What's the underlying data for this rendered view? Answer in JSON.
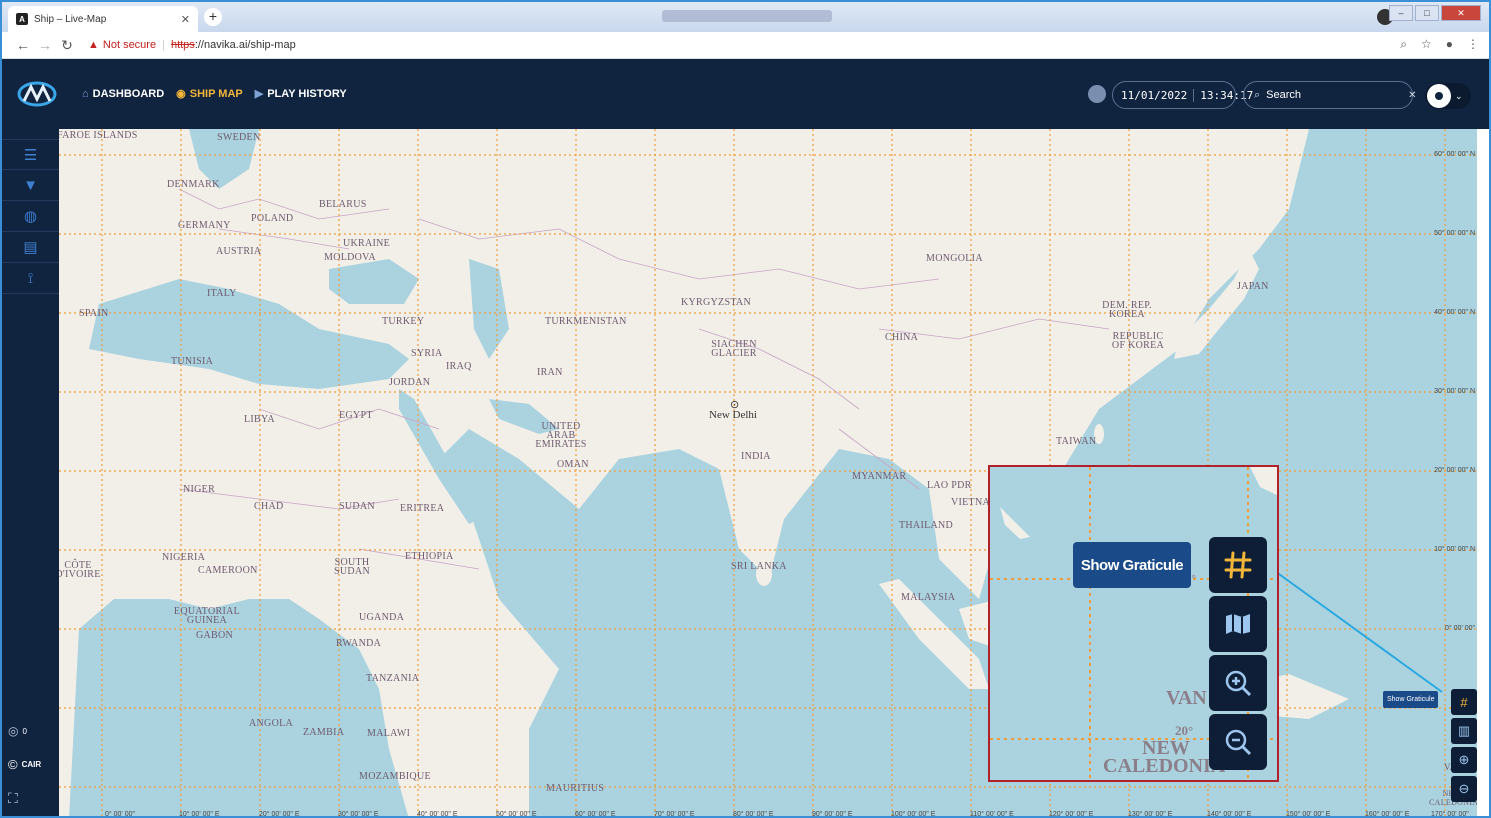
{
  "browser": {
    "tab_title": "Ship – Live-Map",
    "tab_favicon": "A",
    "new_tab": "+",
    "not_secure": "Not secure",
    "url_scheme": "https",
    "url_rest": "://navika.ai/ship-map",
    "window_buttons": [
      "–",
      "□",
      "✕"
    ]
  },
  "header": {
    "nav": [
      {
        "label": "DASHBOARD",
        "icon": "home-icon"
      },
      {
        "label": "SHIP MAP",
        "icon": "target-icon",
        "active": true
      },
      {
        "label": "PLAY HISTORY",
        "icon": "play-icon"
      }
    ],
    "date": "11/01/2022",
    "time": "13:34:17",
    "search_placeholder": "Search"
  },
  "sidebar": {
    "items": [
      {
        "icon": "menu-icon",
        "glyph": "☰"
      },
      {
        "icon": "filter-icon",
        "glyph": "▼"
      },
      {
        "icon": "globe-icon",
        "glyph": "◍"
      },
      {
        "icon": "layers-icon",
        "glyph": "▤"
      },
      {
        "icon": "route-icon",
        "glyph": "⟟"
      }
    ],
    "count": "0",
    "cair_label": "CAIR"
  },
  "map": {
    "countries": [
      {
        "text": "SWEDEN"
      },
      {
        "text": "FAROE ISLANDS"
      },
      {
        "text": "DENMARK"
      },
      {
        "text": "BELARUS"
      },
      {
        "text": "POLAND"
      },
      {
        "text": "GERMANY"
      },
      {
        "text": "UKRAINE"
      },
      {
        "text": "AUSTRIA"
      },
      {
        "text": "MOLDOVA"
      },
      {
        "text": "ITALY"
      },
      {
        "text": "SPAIN"
      },
      {
        "text": "TURKEY"
      },
      {
        "text": "TURKMENISTAN"
      },
      {
        "text": "KYRGYZSTAN"
      },
      {
        "text": "MONGOLIA"
      },
      {
        "text": "JAPAN"
      },
      {
        "text": "DEM. REP. KOREA"
      },
      {
        "text": "REPUBLIC OF KOREA"
      },
      {
        "text": "CHINA"
      },
      {
        "text": "SIACHEN GLACIER"
      },
      {
        "text": "SYRIA"
      },
      {
        "text": "IRAQ"
      },
      {
        "text": "IRAN"
      },
      {
        "text": "JORDAN"
      },
      {
        "text": "TUNISIA"
      },
      {
        "text": "LIBYA"
      },
      {
        "text": "EGYPT"
      },
      {
        "text": "UNITED ARAB EMIRATES"
      },
      {
        "text": "OMAN"
      },
      {
        "text": "INDIA"
      },
      {
        "text": "TAIWAN"
      },
      {
        "text": "MYANMAR"
      },
      {
        "text": "LAO PDR"
      },
      {
        "text": "VIETNAM"
      },
      {
        "text": "THAILAND"
      },
      {
        "text": "NIGER"
      },
      {
        "text": "CHAD"
      },
      {
        "text": "SUDAN"
      },
      {
        "text": "ERITREA"
      },
      {
        "text": "ETHIOPIA"
      },
      {
        "text": "NIGERIA"
      },
      {
        "text": "CAMEROON"
      },
      {
        "text": "SOUTH SUDAN"
      },
      {
        "text": "CÔTE D'IVOIRE"
      },
      {
        "text": "EQUATORIAL GUINEA"
      },
      {
        "text": "GABON"
      },
      {
        "text": "UGANDA"
      },
      {
        "text": "RWANDA"
      },
      {
        "text": "TANZANIA"
      },
      {
        "text": "ANGOLA"
      },
      {
        "text": "ZAMBIA"
      },
      {
        "text": "MALAWI"
      },
      {
        "text": "MOZAMBIQUE"
      },
      {
        "text": "MAURITIUS"
      },
      {
        "text": "SRI LANKA"
      },
      {
        "text": "MALAYSIA"
      },
      {
        "text": "NEW CALEDONIA"
      },
      {
        "text": "VAN"
      }
    ],
    "city": "New Delhi",
    "lat_labels": [
      "60° 00' 00\" N",
      "50° 00' 00\" N",
      "40° 00' 00\" N",
      "30° 00' 00\" N",
      "20° 00' 00\" N",
      "10° 00' 00\" N",
      "0° 00' 00\""
    ],
    "lon_labels": [
      "0° 00' 00\"",
      "10° 00' 00\" E",
      "20° 00' 00\" E",
      "30° 00' 00\" E",
      "40° 00' 00\" E",
      "50° 00' 00\" E",
      "60° 00' 00\" E",
      "70° 00' 00\" E",
      "80° 00' 00\" E",
      "90° 00' 00\" E",
      "100° 00' 00\" E",
      "110° 00' 00\" E",
      "120° 00' 00\" E",
      "130° 00' 00\" E",
      "140° 00' 00\" E",
      "150° 00' 00\" E",
      "160° 00' 00\" E",
      "170° 00' 00\""
    ],
    "controls": [
      {
        "icon": "graticule-icon",
        "glyph": "#"
      },
      {
        "icon": "map-layer-icon",
        "glyph": "▥"
      },
      {
        "icon": "zoom-in-icon",
        "glyph": "⊕"
      },
      {
        "icon": "zoom-out-icon",
        "glyph": "⊖"
      }
    ],
    "tooltip": "Show Graticule"
  },
  "callout": {
    "tooltip": "Show Graticule",
    "map_text_van": "VAN",
    "map_text_new": "NEW",
    "map_text_caledonia": "CALEDONIA",
    "map_text_20": "20°",
    "map_text_10": "0°"
  },
  "colors": {
    "header_bg": "#10233f",
    "accent": "#f4b63a",
    "sea": "#aad3df",
    "land": "#f2efe9",
    "graticule": "#f39c35",
    "callout_border": "#b0212b",
    "tooltip_bg": "#1a4a87",
    "arrow": "#2aa8e0"
  }
}
